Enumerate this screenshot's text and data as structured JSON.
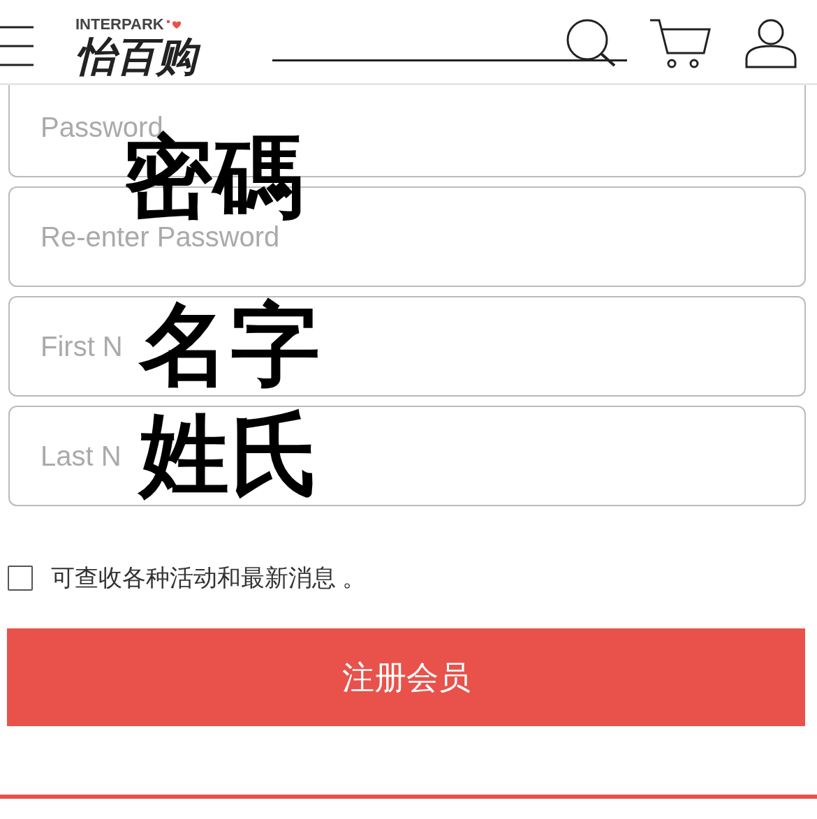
{
  "header": {
    "brand_small": "INTERPARK",
    "brand": "怡百购"
  },
  "fields": [
    {
      "placeholder": "Password",
      "annotation": "密碼"
    },
    {
      "placeholder": "Re-enter Password"
    },
    {
      "placeholder": "First N",
      "annotation": "名字"
    },
    {
      "placeholder": "Last N",
      "annotation": "姓氏"
    }
  ],
  "newsletter": {
    "label": "可查收各种活动和最新消息 。",
    "checked": false
  },
  "submit": "注册会员"
}
